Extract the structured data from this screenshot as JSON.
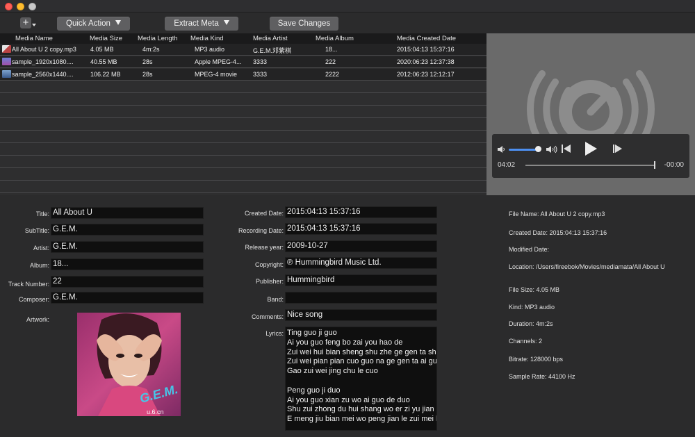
{
  "toolbar": {
    "add_label": "+",
    "quick_action_label": "Quick Action",
    "extract_meta_label": "Extract Meta",
    "save_changes_label": "Save Changes"
  },
  "table": {
    "columns": [
      "Media Name",
      "Media Size",
      "Media Length",
      "Media Kind",
      "Media Artist",
      "Media Album",
      "Media Created Date"
    ],
    "rows": [
      {
        "name": "All About U 2 copy.mp3",
        "size": "4.05 MB",
        "length": "4m:2s",
        "kind": "MP3 audio",
        "artist": "G.E.M.邓紫棋",
        "album": "18...",
        "created": "2015:04:13 15:37:16",
        "icon": "audio-file-icon"
      },
      {
        "name": "sample_1920x1080....",
        "size": "40.55 MB",
        "length": "28s",
        "kind": "Apple MPEG-4...",
        "artist": "3333",
        "album": "222",
        "created": "2020:06:23 12:37:38",
        "icon": "video-file-icon"
      },
      {
        "name": "sample_2560x1440....",
        "size": "106.22 MB",
        "length": "28s",
        "kind": "MPEG-4 movie",
        "artist": "3333",
        "album": "2222",
        "created": "2012:06:23 12:12:17",
        "icon": "video-file-icon"
      }
    ]
  },
  "player": {
    "elapsed": "04:02",
    "remaining": "-00:00",
    "volume": 0.9,
    "progress": 1.0
  },
  "meta_left": {
    "title_label": "Title:",
    "title_value": "All About U",
    "subtitle_label": "SubTitle:",
    "subtitle_value": "G.E.M.",
    "artist_label": "Artist:",
    "artist_value": "G.E.M.",
    "album_label": "Album:",
    "album_value": "18...",
    "track_label": "Track Number:",
    "track_value": "22",
    "composer_label": "Composer:",
    "composer_value": "G.E.M.",
    "artwork_label": "Artwork:"
  },
  "meta_mid": {
    "created_label": "Created Date:",
    "created_value": "2015:04:13 15:37:16",
    "recording_label": "Recording Date:",
    "recording_value": "2015:04:13 15:37:16",
    "release_label": "Release year:",
    "release_value": "2009-10-27",
    "copyright_label": "Copyright:",
    "copyright_value": "℗ Hummingbird Music Ltd.",
    "publisher_label": "Publisher:",
    "publisher_value": "Hummingbird",
    "band_label": "Band:",
    "band_value": "",
    "comments_label": "Comments:",
    "comments_value": "Nice song",
    "lyrics_label": "Lyrics:",
    "lyrics_lines": [
      "Ting guo ji guo",
      "Ai you guo feng bo zai you hao de",
      "Zui wei hui bian sheng shu zhe ge gen ta sh",
      "Zui wei pian pian cuo guo na ge gen ta ai gu",
      "Gao zui wei jing chu le cuo",
      "",
      "Peng guo ji duo",
      "Ai you guo xian zu wo ai guo de duo",
      "Shu zui zhong du hui shang wo er zi yu jian r",
      "E meng jiu bian mei wo peng jian le zui mei h"
    ]
  },
  "info": {
    "file_name": "File Name: All About U 2 copy.mp3",
    "created_date": "Created Date: 2015:04:13 15:37:16",
    "modified_date": "Modified Date:",
    "location": "Location: /Users/fireebok/Movies/mediamata/All About U",
    "file_size": "File Size: 4.05 MB",
    "kind": "Kind: MP3 audio",
    "duration": "Duration: 4m:2s",
    "channels": "Channels: 2",
    "bitrate": "Bitrate: 128000 bps",
    "sample_rate": "Sample Rate: 44100 Hz"
  },
  "artwork": {
    "overlay_text": "u.6.cn",
    "logo_text": "G.E.M."
  },
  "colors": {
    "window_bg": "#2b2b2c",
    "field_bg": "#0f0f0f",
    "player_bg": "#6a6a6a",
    "accent_blue": "#4d8ff0"
  }
}
